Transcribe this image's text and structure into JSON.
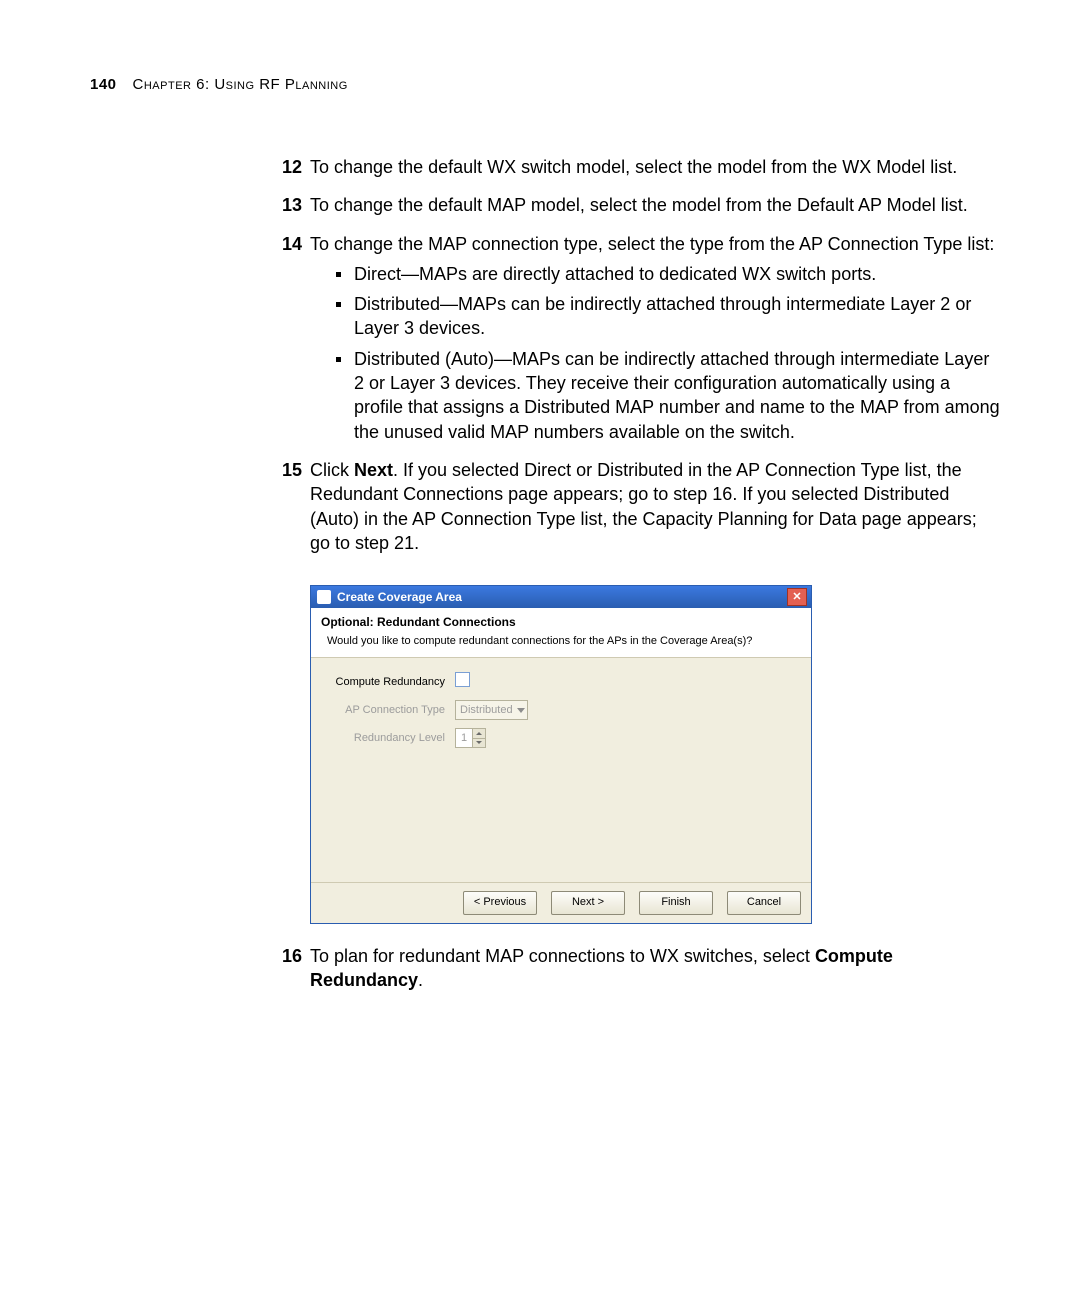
{
  "page_number": "140",
  "chapter_title": "Chapter 6: Using RF Planning",
  "steps": {
    "s12": {
      "num": "12",
      "text": "To change the default WX switch model, select the model from the WX Model list."
    },
    "s13": {
      "num": "13",
      "text": "To change the default MAP model, select the model from the Default AP Model list."
    },
    "s14": {
      "num": "14",
      "text": "To change the MAP connection type, select the type from the AP Connection Type list:",
      "bullets": {
        "b1": "Direct—MAPs are directly attached to dedicated WX switch ports.",
        "b2": "Distributed—MAPs can be indirectly attached through intermediate Layer 2 or Layer 3 devices.",
        "b3": "Distributed (Auto)—MAPs can be indirectly attached through intermediate Layer 2 or Layer 3 devices. They receive their configuration automatically using a profile that assigns a Distributed MAP number and name to the MAP from among the unused valid MAP numbers available on the switch."
      }
    },
    "s15": {
      "num": "15",
      "pre": "Click ",
      "bold": "Next",
      "post": ". If you selected Direct or Distributed in the AP Connection Type list, the Redundant Connections page appears; go to step 16. If you selected Distributed (Auto) in the AP Connection Type list, the Capacity Planning for Data page appears; go to step 21."
    },
    "s16": {
      "num": "16",
      "pre": "To plan for redundant MAP connections to WX switches, select ",
      "bold": "Compute Redundancy",
      "post": "."
    }
  },
  "dialog": {
    "title": "Create Coverage Area",
    "header_title": "Optional: Redundant Connections",
    "header_desc": "Would you like to compute redundant connections for the APs in the Coverage Area(s)?",
    "labels": {
      "compute_redundancy": "Compute Redundancy",
      "ap_connection_type": "AP Connection Type",
      "redundancy_level": "Redundancy Level"
    },
    "values": {
      "ap_connection_type": "Distributed",
      "redundancy_level": "1"
    },
    "buttons": {
      "previous": "< Previous",
      "next": "Next >",
      "finish": "Finish",
      "cancel": "Cancel"
    }
  }
}
